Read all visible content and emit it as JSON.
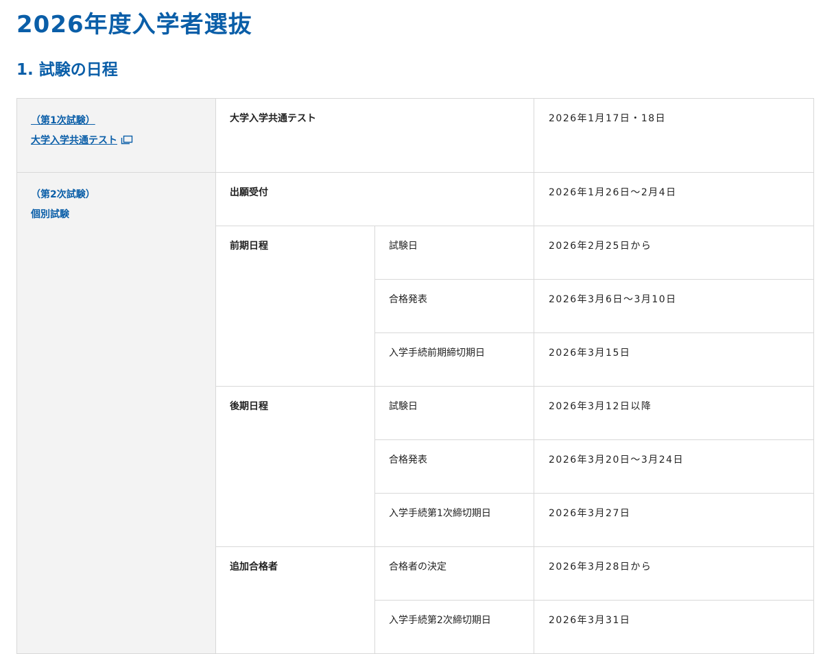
{
  "page": {
    "title": "2026年度入学者選抜",
    "section_title": "1. 試験の日程"
  },
  "schedule": {
    "first": {
      "group_label": "（第1次試験）",
      "group_link": "大学入学共通テスト",
      "link_icon": "external-window-icon",
      "event": "大学入学共通テスト",
      "date": "2026年1月17日・18日"
    },
    "second": {
      "group_label": "（第2次試験）",
      "group_name": "個別試験",
      "application": {
        "event": "出願受付",
        "date": "2026年1月26日～2月4日"
      },
      "early": {
        "event": "前期日程",
        "rows": [
          {
            "item": "試験日",
            "date": "2026年2月25日から"
          },
          {
            "item": "合格発表",
            "date": "2026年3月6日～3月10日"
          },
          {
            "item": "入学手続前期締切期日",
            "date": "2026年3月15日"
          }
        ]
      },
      "late": {
        "event": "後期日程",
        "rows": [
          {
            "item": "試験日",
            "date": "2026年3月12日以降"
          },
          {
            "item": "合格発表",
            "date": "2026年3月20日～3月24日"
          },
          {
            "item": "入学手続第1次締切期日",
            "date": "2026年3月27日"
          }
        ]
      },
      "additional": {
        "event": "追加合格者",
        "rows": [
          {
            "item": "合格者の決定",
            "date": "2026年3月28日から"
          },
          {
            "item": "入学手続第2次締切期日",
            "date": "2026年3月31日"
          }
        ]
      }
    }
  }
}
